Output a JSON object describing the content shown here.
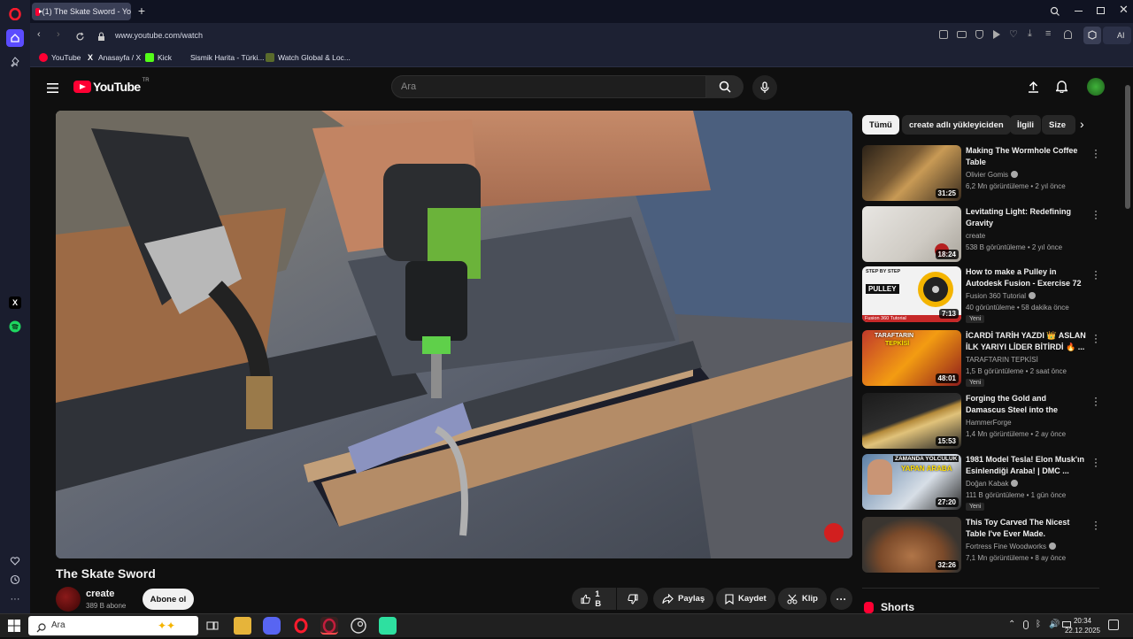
{
  "browser": {
    "tab_title": "(1) The Skate Sword - Yo",
    "url": "www.youtube.com/watch",
    "ai_label": "AI",
    "bookmarks": [
      {
        "label": "YouTube",
        "icon": "youtube-icon"
      },
      {
        "label": "Anasayfa / X",
        "icon": "x-icon"
      },
      {
        "label": "Kick",
        "icon": "kick-icon"
      },
      {
        "label": "Sismik Harita - Türki...",
        "icon": "map-icon"
      },
      {
        "label": "Watch Global & Loc...",
        "icon": "tv-icon"
      }
    ]
  },
  "header": {
    "logo_text": "YouTube",
    "country_code": "TR",
    "search_placeholder": "Ara"
  },
  "video": {
    "title": "The Skate Sword",
    "channel": "create",
    "subscribers": "389 B abone",
    "subscribe_label": "Abone ol",
    "likes": "1 B",
    "share_label": "Paylaş",
    "save_label": "Kaydet",
    "clip_label": "Klip"
  },
  "chips": [
    "Tümü",
    "create adlı yükleyiciden",
    "İlgili",
    "Size"
  ],
  "recommendations": [
    {
      "title": "Making The Wormhole Coffee Table",
      "channel": "Olivier Gomis",
      "verified": true,
      "meta": "6,2 Mn görüntüleme • 2 yıl önce",
      "duration": "31:25",
      "new": ""
    },
    {
      "title": "Levitating Light: Redefining Gravity",
      "channel": "create",
      "verified": false,
      "meta": "538 B görüntüleme • 2 yıl önce",
      "duration": "18:24",
      "new": ""
    },
    {
      "title": "How to make a Pulley in Autodesk Fusion - Exercise 72",
      "channel": "Fusion 360 Tutorial",
      "verified": true,
      "meta": "40 görüntüleme • 58 dakika önce",
      "duration": "7:13",
      "new": "Yeni",
      "thumb_text_1": "STEP BY STEP",
      "thumb_text_2": "PULLEY",
      "thumb_text_3": "Fusion 360 Tutorial"
    },
    {
      "title": "İCARDİ TARİH YAZDI 👑 ASLAN İLK YARIYI LİDER BİTİRDİ 🔥 ...",
      "channel": "TARAFTARIN TEPKİSİ",
      "verified": false,
      "meta": "1,5 B görüntüleme • 2 saat önce",
      "duration": "48:01",
      "new": "Yeni",
      "thumb_text_1": "TARAFTARIN",
      "thumb_text_2": "TEPKİSİ"
    },
    {
      "title": "Forging the Gold and Damascus Steel into the Ultimate ...",
      "channel": "HammerForge",
      "verified": false,
      "meta": "1,4 Mn görüntüleme • 2 ay önce",
      "duration": "15:53",
      "new": ""
    },
    {
      "title": "1981 Model Tesla! Elon Musk'ın Esinlendiği Araba! | DMC ...",
      "channel": "Doğan Kabak",
      "verified": true,
      "meta": "111 B görüntüleme • 1 gün önce",
      "duration": "27:20",
      "new": "Yeni",
      "thumb_text_1": "ZAMANDA YOLCULUK",
      "thumb_text_2": "YAPAN ARABA"
    },
    {
      "title": "This Toy Carved The Nicest Table I've Ever Made.",
      "channel": "Fortress Fine Woodworks",
      "verified": true,
      "meta": "7,1 Mn görüntüleme • 8 ay önce",
      "duration": "32:26",
      "new": ""
    }
  ],
  "shorts_label": "Shorts",
  "taskbar": {
    "search_placeholder": "Ara",
    "time": "20:34",
    "date": "22.12.2025"
  }
}
